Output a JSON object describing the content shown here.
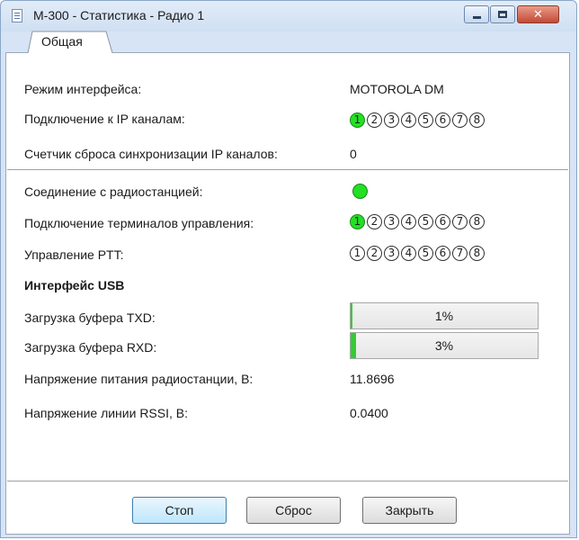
{
  "window": {
    "title": "M-300 - Статистика - Радио 1",
    "icons": [
      "app-document-icon",
      "minimize-icon",
      "maximize-icon",
      "close-icon"
    ]
  },
  "tabs": [
    {
      "label": "Общая",
      "active": true
    }
  ],
  "fields": {
    "interface_mode": {
      "label": "Режим интерфейса:",
      "value": "MOTOROLA DM"
    },
    "ip_channels": {
      "label": "Подключение к IP каналам:",
      "numbers": [
        "1",
        "2",
        "3",
        "4",
        "5",
        "6",
        "7",
        "8"
      ],
      "active": [
        1
      ]
    },
    "sync_reset": {
      "label": "Счетчик сброса синхронизации IP каналов:",
      "value": "0"
    },
    "radio_connection": {
      "label": "Соединение с радиостанцией:",
      "status": "connected"
    },
    "control_terminals": {
      "label": "Подключение терминалов управления:",
      "numbers": [
        "1",
        "2",
        "3",
        "4",
        "5",
        "6",
        "7",
        "8"
      ],
      "active": [
        1
      ]
    },
    "ptt_control": {
      "label": "Управление PTT:",
      "numbers": [
        "1",
        "2",
        "3",
        "4",
        "5",
        "6",
        "7",
        "8"
      ],
      "active": []
    }
  },
  "usb": {
    "heading": "Интерфейс USB",
    "txd": {
      "label": "Загрузка буфера TXD:",
      "value_text": "1%",
      "percent": 1
    },
    "rxd": {
      "label": "Загрузка буфера RXD:",
      "value_text": "3%",
      "percent": 3
    },
    "supply_voltage": {
      "label": "Напряжение питания радиостанции, В:",
      "value": "11.8696"
    },
    "rssi_voltage": {
      "label": "Напряжение линии RSSI, В:",
      "value": "0.0400"
    }
  },
  "buttons": {
    "stop": "Стоп",
    "reset": "Сброс",
    "close": "Закрыть"
  },
  "colors": {
    "active": "#22e024",
    "progress": "#33cc33",
    "primary_button": "#bee6fd"
  }
}
